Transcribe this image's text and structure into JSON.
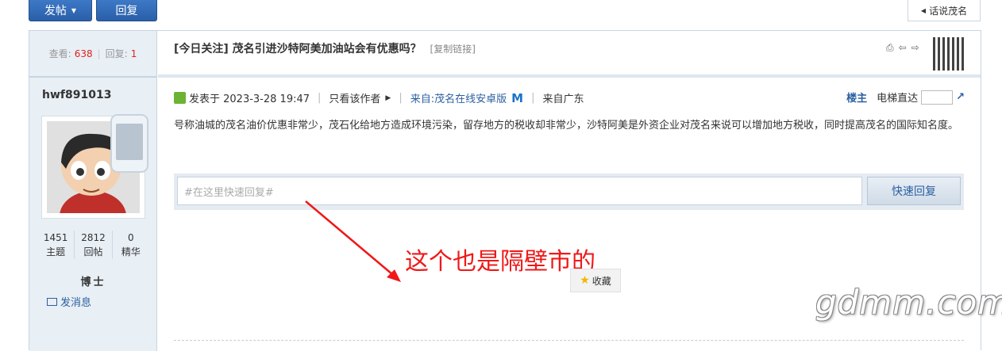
{
  "toolbar": {
    "post_label": "发帖",
    "reply_label": "回复",
    "forum_link": "话说茂名"
  },
  "stats": {
    "views_label": "查看:",
    "views": "638",
    "replies_label": "回复:",
    "replies": "1"
  },
  "thread": {
    "title": "[今日关注] 茂名引进沙特阿美加油站会有优惠吗？",
    "copy_link": "[复制链接]"
  },
  "author": {
    "name": "hwf891013",
    "counts": [
      {
        "value": "1451",
        "label": "主题"
      },
      {
        "value": "2812",
        "label": "回帖"
      },
      {
        "value": "0",
        "label": "精华"
      }
    ],
    "rank": "博士",
    "send_message": "发消息"
  },
  "post": {
    "posted_at": "发表于 2023-3-28 19:47",
    "only_author": "只看该作者",
    "source_app": "来自:茂名在线安卓版",
    "source_region": "来自广东",
    "floor_label": "楼主",
    "jump_label": "电梯直达",
    "content": "号称油城的茂名油价优惠非常少，茂石化给地方造成环境污染，留存地方的税收却非常少，沙特阿美是外资企业对茂名来说可以增加地方税收，同时提高茂名的国际知名度。"
  },
  "quick_reply": {
    "placeholder": "#在这里快速回复#",
    "button": "快速回复"
  },
  "annotation": "这个也是隔壁市的",
  "favorite": "收藏",
  "watermark": "gdmm.com"
}
